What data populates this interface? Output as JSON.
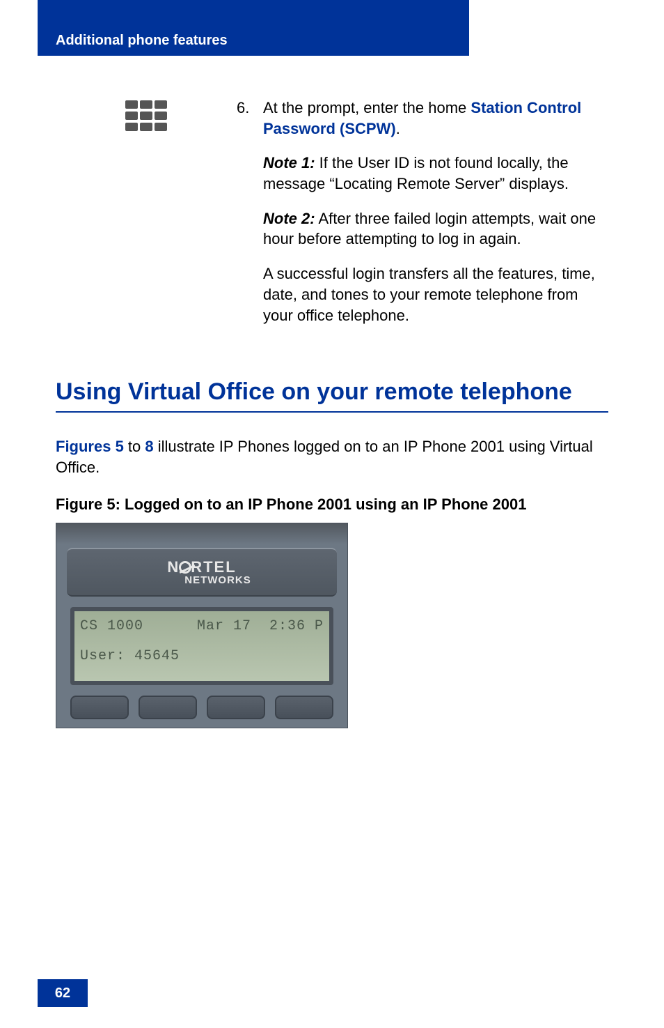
{
  "header": {
    "title": "Additional phone features"
  },
  "step": {
    "number": "6.",
    "prompt_prefix": "At the prompt, enter the home ",
    "scpw": "Station Control Password (SCPW)",
    "period": ".",
    "note1_label": "Note 1:",
    "note1_text": " If the User ID is not found locally, the message “Locating Remote Server” displays.",
    "note2_label": "Note 2:",
    "note2_text": " After three failed login attempts, wait one hour before attempting to log in again.",
    "success_text": "A successful login transfers all the features, time, date, and tones to your remote telephone from your office telephone."
  },
  "section": {
    "heading": "Using Virtual Office on your remote telephone"
  },
  "intro": {
    "figures_word": "Figures 5",
    "to_word": " to ",
    "fig_end": "8",
    "rest": " illustrate IP Phones logged on to an IP Phone 2001 using Virtual Office."
  },
  "figure": {
    "caption": "Figure 5: Logged on to an IP Phone 2001 using an IP Phone 2001",
    "logo_line1_pre": "N",
    "logo_line1_post": "RTEL",
    "logo_line2": "NETWORKS",
    "screen_left": "CS 1000",
    "screen_date": "Mar 17",
    "screen_time": "2:36 P",
    "screen_user": "User: 45645"
  },
  "page_number": "62"
}
